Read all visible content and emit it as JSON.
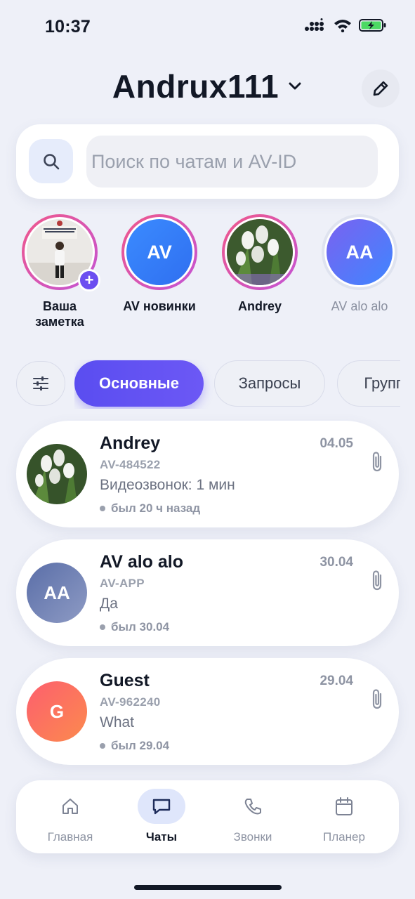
{
  "status_bar": {
    "time": "10:37",
    "icons": [
      "signal-icon",
      "wifi-icon",
      "battery-charging-icon"
    ]
  },
  "header": {
    "title": "Andrux111",
    "dropdown_icon": "chevron-down-icon",
    "edit_icon": "pencil-icon"
  },
  "search": {
    "icon": "search-icon",
    "placeholder": "Поиск по чатам и AV-ID",
    "value": ""
  },
  "stories": [
    {
      "label_line1": "Ваша",
      "label_line2": "заметка",
      "type": "photo-person",
      "has_add": true
    },
    {
      "label_line1": "AV новинки",
      "initials": "AV",
      "type": "initials"
    },
    {
      "label_line1": "Andrey",
      "type": "photo-tulips"
    },
    {
      "label_line1": "AV alo alo",
      "initials": "AA",
      "type": "initials",
      "muted": true
    }
  ],
  "tabs": {
    "filter_icon": "sliders-icon",
    "items": [
      {
        "label": "Основные",
        "active": true
      },
      {
        "label": "Запросы",
        "active": false
      },
      {
        "label": "Группы",
        "active": false
      }
    ]
  },
  "chats": [
    {
      "name": "Andrey",
      "date": "04.05",
      "id": "AV-484522",
      "message": "Видеозвонок: 1 мин",
      "seen": "был 20 ч назад",
      "avatar": "photo-tulips"
    },
    {
      "name": "AV alo alo",
      "date": "30.04",
      "id": "AV-APP",
      "message": "Да",
      "seen": "был 30.04",
      "initials": "AA",
      "avatar_color": "#6c7fb4"
    },
    {
      "name": "Guest",
      "date": "29.04",
      "id": "AV-962240",
      "message": "What",
      "seen": "был 29.04",
      "initials": "G",
      "avatar_color": "#fb6e62"
    }
  ],
  "bottom_nav": [
    {
      "label": "Главная",
      "icon": "home-icon",
      "active": false
    },
    {
      "label": "Чаты",
      "icon": "chat-icon",
      "active": true
    },
    {
      "label": "Звонки",
      "icon": "phone-icon",
      "active": false
    },
    {
      "label": "Планер",
      "icon": "calendar-icon",
      "active": false
    }
  ],
  "colors": {
    "accent": "#5c4ef0",
    "background": "#eef0f8",
    "story_ring": "#e85a92"
  }
}
